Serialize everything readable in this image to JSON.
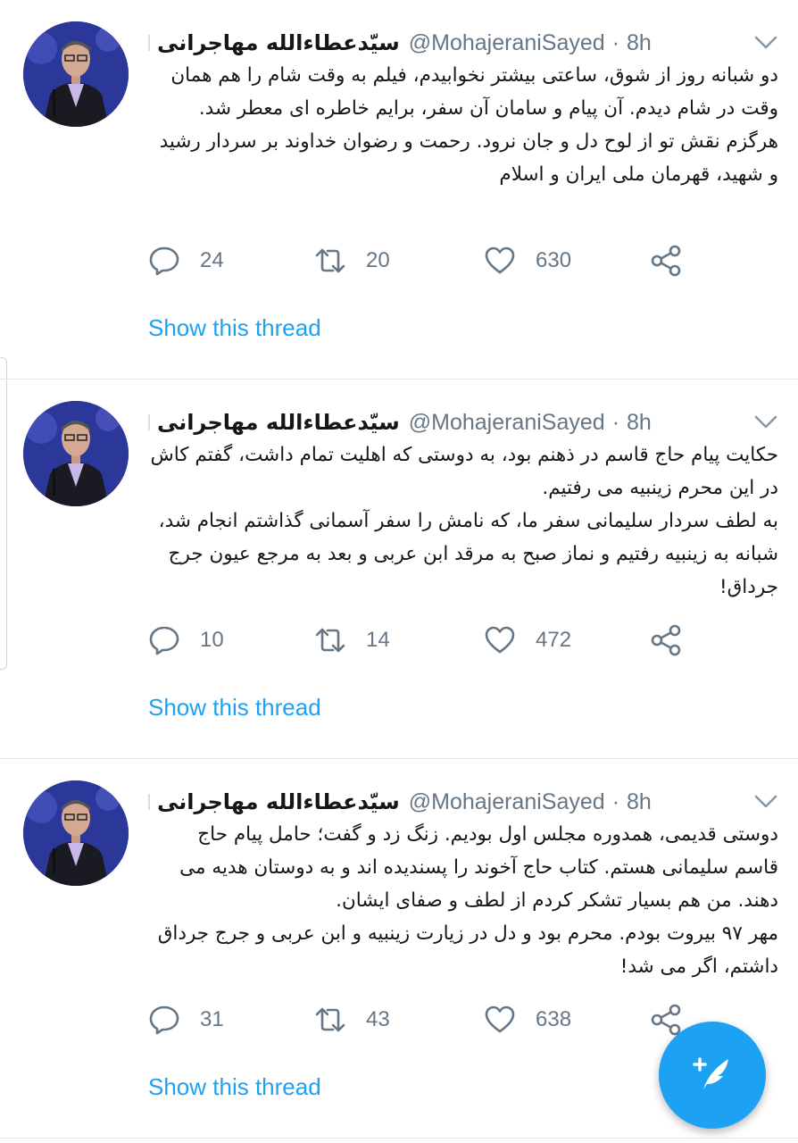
{
  "colors": {
    "accent": "#1da1f2",
    "text_primary": "#14171a",
    "text_secondary": "#657786",
    "divider": "#e1e8ed",
    "flag_green": "#239f40",
    "flag_white": "#ffffff",
    "flag_red": "#da0000"
  },
  "tweets": [
    {
      "author_name": "سیّدعطاءالله مهاجرانی",
      "handle": "@MohajeraniSayed",
      "time": "8h",
      "text": "دو شبانه روز از شوق، ساعتی بیشتر نخوابیدم، فیلم به وقت شام را هم همان وقت در شام دیدم. آن پیام و سامان آن سفر، برایم خاطره ای معطر شد.\nهرگزم نقش تو از لوح دل و جان نرود. رحمت و رضوان خداوند بر سردار رشید و شهید، قهرمان ملی ایران و اسلام",
      "replies": "24",
      "retweets": "20",
      "likes": "630",
      "show_thread": "Show this thread",
      "icons": [
        "flag-iran-icon",
        "chevron-down-icon",
        "reply-icon",
        "retweet-icon",
        "like-icon",
        "share-icon"
      ]
    },
    {
      "author_name": "سیّدعطاءالله مهاجرانی",
      "handle": "@MohajeraniSayed",
      "time": "8h",
      "text": "حکایت پیام حاج قاسم در ذهنم بود، به دوستی که اهلیت تمام داشت، گفتم کاش در این محرم زینبیه می رفتیم.\nبه لطف سردار سلیمانی سفر ما، که نامش را سفر آسمانی گذاشتم انجام شد، شبانه به زینبیه رفتیم و نماز صبح به مرقد ابن عربی و بعد به مرجع عیون جرج جرداق!",
      "replies": "10",
      "retweets": "14",
      "likes": "472",
      "show_thread": "Show this thread"
    },
    {
      "author_name": "سیّدعطاءالله مهاجرانی",
      "handle": "@MohajeraniSayed",
      "time": "8h",
      "text": "دوستی قدیمی، همدوره مجلس اول بودیم. زنگ زد و گفت؛ حامل پیام حاج قاسم سلیمانی هستم. کتاب حاج آخوند را پسندیده اند و به دوستان هدیه می دهند. من هم بسیار تشکر کردم از لطف و صفای ایشان.\nمهر ۹۷ بیروت بودم. محرم بود و دل در زیارت زینبیه و ابن عربی و جرج جرداق داشتم، اگر می شد!",
      "replies": "31",
      "retweets": "43",
      "likes": "638",
      "show_thread": "Show this thread"
    }
  ],
  "fab": {
    "icon": "compose-tweet-icon"
  }
}
